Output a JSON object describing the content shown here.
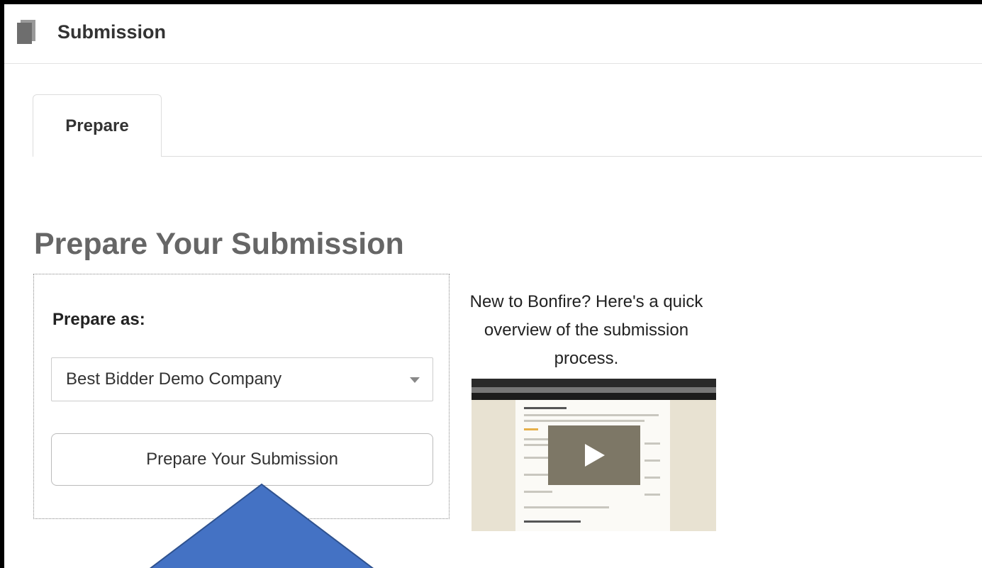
{
  "header": {
    "title": "Submission",
    "icon": "document-icon"
  },
  "tabs": [
    {
      "label": "Prepare",
      "active": true
    }
  ],
  "main": {
    "title": "Prepare Your Submission",
    "prepare_as_label": "Prepare as:",
    "company_select": {
      "value": "Best Bidder Demo Company"
    },
    "prepare_button_label": "Prepare Your Submission",
    "overview_text": "New to Bonfire? Here's a quick overview of the submission process.",
    "video": {
      "icon": "play-icon"
    }
  },
  "colors": {
    "arrow_fill": "#4472c4",
    "arrow_stroke": "#2f528f",
    "heading": "#666666"
  }
}
